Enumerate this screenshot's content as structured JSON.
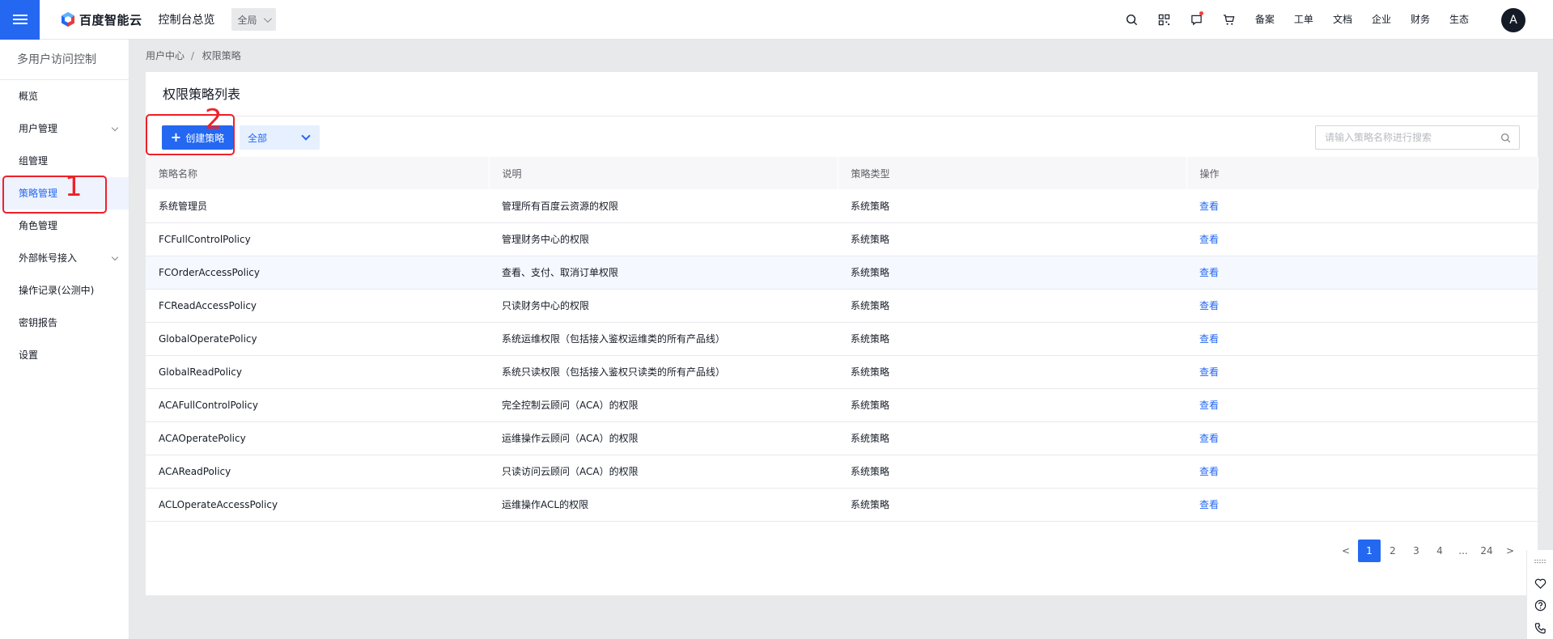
{
  "topbar": {
    "logo_text": "百度智能云",
    "title": "控制台总览",
    "region": "全局",
    "links": [
      "备案",
      "工单",
      "文档",
      "企业",
      "财务",
      "生态"
    ],
    "avatar_letter": "A",
    "accent": "#2468f2"
  },
  "sidebar": {
    "title": "多用户访问控制",
    "items": [
      {
        "label": "概览"
      },
      {
        "label": "用户管理"
      },
      {
        "label": "组管理"
      },
      {
        "label": "策略管理"
      },
      {
        "label": "角色管理"
      },
      {
        "label": "外部帐号接入"
      },
      {
        "label": "操作记录(公测中)"
      },
      {
        "label": "密钥报告"
      },
      {
        "label": "设置"
      }
    ]
  },
  "breadcrumb": {
    "parent": "用户中心",
    "sep": "/",
    "current": "权限策略"
  },
  "panel": {
    "title": "权限策略列表",
    "create_label": "创建策略",
    "filter_value": "全部",
    "search_placeholder": "请输入策略名称进行搜索"
  },
  "table": {
    "headers": [
      "策略名称",
      "说明",
      "策略类型",
      "操作"
    ],
    "rows": [
      {
        "name": "系统管理员",
        "desc": "管理所有百度云资源的权限",
        "type": "系统策略",
        "action": "查看"
      },
      {
        "name": "FCFullControlPolicy",
        "desc": "管理财务中心的权限",
        "type": "系统策略",
        "action": "查看"
      },
      {
        "name": "FCOrderAccessPolicy",
        "desc": "查看、支付、取消订单权限",
        "type": "系统策略",
        "action": "查看"
      },
      {
        "name": "FCReadAccessPolicy",
        "desc": "只读财务中心的权限",
        "type": "系统策略",
        "action": "查看"
      },
      {
        "name": "GlobalOperatePolicy",
        "desc": "系统运维权限（包括接入鉴权运维类的所有产品线）",
        "type": "系统策略",
        "action": "查看"
      },
      {
        "name": "GlobalReadPolicy",
        "desc": "系统只读权限（包括接入鉴权只读类的所有产品线）",
        "type": "系统策略",
        "action": "查看"
      },
      {
        "name": "ACAFullControlPolicy",
        "desc": "完全控制云顾问（ACA）的权限",
        "type": "系统策略",
        "action": "查看"
      },
      {
        "name": "ACAOperatePolicy",
        "desc": "运维操作云顾问（ACA）的权限",
        "type": "系统策略",
        "action": "查看"
      },
      {
        "name": "ACAReadPolicy",
        "desc": "只读访问云顾问（ACA）的权限",
        "type": "系统策略",
        "action": "查看"
      },
      {
        "name": "ACLOperateAccessPolicy",
        "desc": "运维操作ACL的权限",
        "type": "系统策略",
        "action": "查看"
      }
    ]
  },
  "pagination": {
    "prev": "<",
    "pages": [
      "1",
      "2",
      "3",
      "4",
      "...",
      "24"
    ],
    "next": ">",
    "current": "1"
  },
  "annotations": {
    "step1": "1",
    "step2": "2",
    "color": "#f0202a"
  }
}
